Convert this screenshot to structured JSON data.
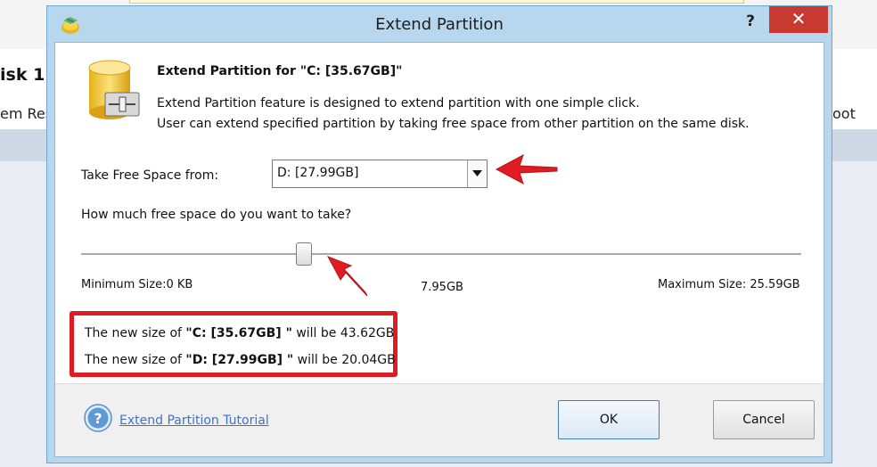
{
  "background": {
    "disk_label": "isk 1",
    "row_left": "em Res",
    "row_right": "oot"
  },
  "window": {
    "title": "Extend Partition",
    "help_label": "?",
    "close_label": "✕"
  },
  "header": {
    "heading": "Extend Partition for \"C: [35.67GB]\"",
    "description_line1": "Extend Partition feature is designed to extend partition with one simple click.",
    "description_line2": "User can extend specified partition by taking free space from other partition on the same disk."
  },
  "source": {
    "label": "Take Free Space from:",
    "selected": "D:  [27.99GB]"
  },
  "slider": {
    "question": "How much free space do you want to take?",
    "min_label": "Minimum Size:0 KB",
    "current_value": "7.95GB",
    "max_label": "Maximum Size: 25.59GB",
    "position_fraction": 0.31
  },
  "result": {
    "line1_prefix": "The new size of ",
    "line1_partition": "\"C: [35.67GB] \"",
    "line1_suffix": " will be 43.62GB",
    "line2_prefix": "The new size of ",
    "line2_partition": "\"D: [27.99GB] \"",
    "line2_suffix": " will be 20.04GB"
  },
  "footer": {
    "tutorial_link": "Extend Partition Tutorial",
    "ok_label": "OK",
    "cancel_label": "Cancel"
  },
  "colors": {
    "highlight_red": "#e01b22",
    "link_blue": "#3f74c8",
    "window_frame": "#b7d7ef",
    "close_red": "#c83a31"
  },
  "icons": [
    "app-icon",
    "partition-drive-icon",
    "dropdown-arrow-icon",
    "help-circle-icon",
    "annotation-arrow"
  ]
}
